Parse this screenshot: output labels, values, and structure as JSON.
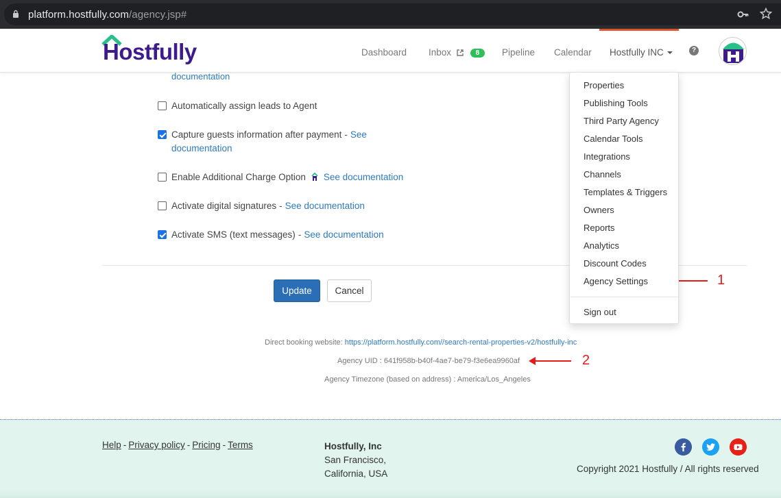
{
  "browser": {
    "url_host": "platform.hostfully.com",
    "url_path": "/agency.jsp#"
  },
  "header": {
    "logo_text": "Hostfully",
    "nav": {
      "dashboard": "Dashboard",
      "inbox": "Inbox",
      "inbox_badge": "8",
      "pipeline": "Pipeline",
      "calendar": "Calendar",
      "agency": "Hostfully INC"
    },
    "help_glyph": "?"
  },
  "settings": {
    "top_doc_link": "documentation",
    "options": [
      {
        "label": "Automatically assign leads to Agent",
        "checked": false
      },
      {
        "label": "Capture guests information after payment",
        "checked": true,
        "sep": "-",
        "link_part1": "See",
        "link_part2": "documentation"
      },
      {
        "label": "Enable Additional Charge Option",
        "checked": false,
        "icon": "hostfully-house-icon",
        "link": "See documentation"
      },
      {
        "label": "Activate digital signatures",
        "checked": false,
        "sep": "-",
        "link": "See documentation"
      },
      {
        "label": "Activate SMS (text messages)",
        "checked": true,
        "sep": "-",
        "link": "See documentation"
      }
    ],
    "update_label": "Update",
    "cancel_label": "Cancel"
  },
  "info": {
    "booking_label": "Direct booking website:",
    "booking_url": "https://platform.hostfully.com//search-rental-properties-v2/hostfully-inc",
    "uid": "Agency UID : 641f958b-b40f-4ae7-be79-f3e6ea9960af",
    "timezone": "Agency Timezone (based on address) : America/Los_Angeles"
  },
  "dropdown": {
    "items": [
      "Properties",
      "Publishing Tools",
      "Third Party Agency",
      "Calendar Tools",
      "Integrations",
      "Channels",
      "Templates & Triggers",
      "Owners",
      "Reports",
      "Analytics",
      "Discount Codes",
      "Agency Settings"
    ],
    "sign_out": "Sign out"
  },
  "annotations": {
    "label1": "1",
    "label2": "2",
    "color": "#e41b1b"
  },
  "footer": {
    "links": [
      "Help",
      "Privacy policy",
      "Pricing",
      "Terms"
    ],
    "separator": "-",
    "company_name": "Hostfully, Inc",
    "city": "San Francisco,",
    "region": "California, USA",
    "copyright": "Copyright 2021 Hostfully / All rights reserved",
    "social": [
      "facebook-icon",
      "twitter-icon",
      "youtube-icon"
    ]
  },
  "colors": {
    "brand_purple": "#3d1b8c",
    "brand_green": "#27c08a",
    "link_blue": "#2d7ac0",
    "primary_button": "#2a6fb6",
    "footer_bg": "#e1f4ee"
  }
}
